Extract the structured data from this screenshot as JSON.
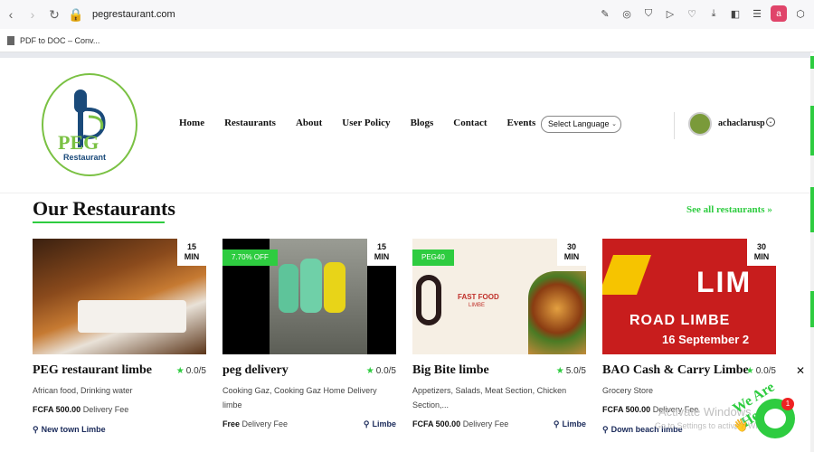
{
  "browser": {
    "url": "pegrestaurant.com",
    "bookmark": "PDF to DOC – Conv...",
    "profile_letter": "a"
  },
  "site": {
    "logo_text": "PEG",
    "logo_sub": "Restaurant",
    "nav": [
      "Home",
      "Restaurants",
      "About",
      "User Policy",
      "Blogs",
      "Contact",
      "Events"
    ],
    "language_select": "Select Language",
    "username": "achaclarusp"
  },
  "section": {
    "title": "Our Restaurants",
    "see_all": "See all restaurants"
  },
  "restaurants": [
    {
      "name": "PEG restaurant limbe",
      "rating": "0.0/5",
      "time": "15",
      "time_unit": "MIN",
      "badge": "",
      "cuisine": "African food, Drinking water",
      "fee": "FCFA 500.00",
      "fee_label": "Delivery Fee",
      "location": "New town Limbe"
    },
    {
      "name": "peg delivery",
      "rating": "0.0/5",
      "time": "15",
      "time_unit": "MIN",
      "badge": "7.70% OFF",
      "cuisine": "Cooking Gaz, Cooking Gaz Home Delivery limbe",
      "fee": "Free",
      "fee_label": "Delivery Fee",
      "location": "Limbe"
    },
    {
      "name": "Big Bite limbe",
      "rating": "5.0/5",
      "time": "30",
      "time_unit": "MIN",
      "badge": "PEG40",
      "cuisine": "Appetizers, Salads, Meat Section, Chicken Section,...",
      "fee": "FCFA 500.00",
      "fee_label": "Delivery Fee",
      "location": "Limbe",
      "image_text": "FAST FOOD",
      "image_subtext": "LIMBE"
    },
    {
      "name": "BAO Cash & Carry Limbe",
      "rating": "0.0/5",
      "time": "30",
      "time_unit": "MIN",
      "badge": "",
      "cuisine": "Grocery Store",
      "fee": "FCFA 500.00",
      "fee_label": "Delivery Fee",
      "location": "Down beach limbe",
      "image_text": "LIM",
      "image_line2": "ROAD LIMBE",
      "image_line3": "16 September 2"
    }
  ],
  "widgets": {
    "watermark": "Activate Windows",
    "watermark_sub": "Go to Settings to activate Windows.",
    "chat_label": "We Are Here!",
    "chat_count": "1"
  },
  "colors": {
    "accent_green": "#2ecc40",
    "logo_green": "#7ac143",
    "navy": "#1a2a5a"
  }
}
